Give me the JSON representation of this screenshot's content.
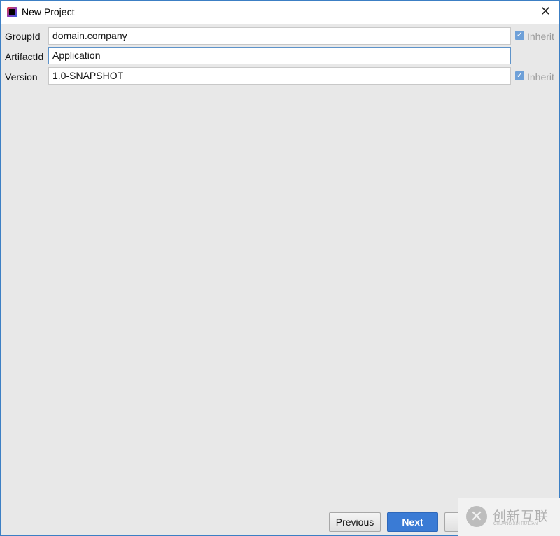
{
  "window": {
    "title": "New Project",
    "close_icon": "close-icon",
    "app_icon": "intellij-icon"
  },
  "form": {
    "group_id": {
      "label": "GroupId",
      "value": "domain.company",
      "inherit_label": "Inherit",
      "inherit_checked": true
    },
    "artifact_id": {
      "label": "ArtifactId",
      "value": "Application"
    },
    "version": {
      "label": "Version",
      "value": "1.0-SNAPSHOT",
      "inherit_label": "Inherit",
      "inherit_checked": true
    }
  },
  "buttons": {
    "previous": "Previous",
    "next": "Next"
  },
  "watermark": {
    "cn": "创新互联",
    "en": "CHUANG XIN HU LIAN"
  },
  "colors": {
    "accent": "#3a7bd5",
    "border": "#3c7fc4"
  }
}
